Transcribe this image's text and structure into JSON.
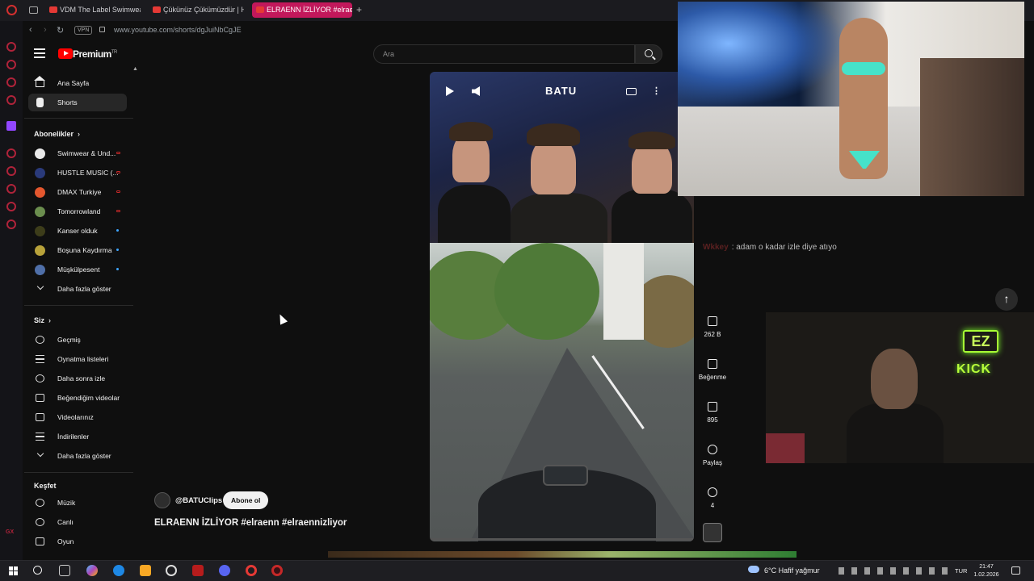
{
  "browser": {
    "tabs": [
      {
        "label": "VDM The Label Swimwear",
        "active": false
      },
      {
        "label": "Çükünüz Çükümüzdür | H",
        "active": false
      },
      {
        "label": "ELRAENN İZLİYOR #elraenn",
        "active": true
      }
    ],
    "vpn_label": "VPN",
    "url": "www.youtube.com/shorts/dgJuiNbCgJE",
    "accent_color": "#c2185b"
  },
  "header": {
    "logo_text": "Premium",
    "logo_sup": "TR",
    "search_placeholder": "Ara"
  },
  "sidebar": {
    "main": [
      {
        "label": "Ana Sayfa",
        "icon": "home-icon"
      },
      {
        "label": "Shorts",
        "icon": "shorts-icon",
        "active": true
      }
    ],
    "subscriptions_title": "Abonelikler",
    "subscriptions": [
      {
        "label": "Swimwear & Und...",
        "avatar_color": "#e9e9e9",
        "status": "live"
      },
      {
        "label": "HUSTLE MUSIC (...",
        "avatar_color": "#2a3a7a",
        "status": "live"
      },
      {
        "label": "DMAX Turkiye",
        "avatar_color": "#e4572e",
        "status": "live"
      },
      {
        "label": "Tomorrowland",
        "avatar_color": "#6b8e4e",
        "status": "live"
      },
      {
        "label": "Kanser olduk",
        "avatar_color": "#3d3d1a",
        "status": "new"
      },
      {
        "label": "Boşuna Kaydırma",
        "avatar_color": "#b8a23a",
        "status": "new"
      },
      {
        "label": "Müşkülpesent",
        "avatar_color": "#4f6fa8",
        "status": "new"
      }
    ],
    "subscriptions_more": "Daha fazla göster",
    "you_title": "Siz",
    "you_items": [
      {
        "label": "Geçmiş",
        "icon": "history-icon"
      },
      {
        "label": "Oynatma listeleri",
        "icon": "playlist-icon"
      },
      {
        "label": "Daha sonra izle",
        "icon": "clock-icon"
      },
      {
        "label": "Beğendiğim videolar",
        "icon": "thumbs-up-icon"
      },
      {
        "label": "Videolarınız",
        "icon": "video-icon"
      },
      {
        "label": "İndirilenler",
        "icon": "download-icon"
      }
    ],
    "you_more": "Daha fazla göster",
    "explore_title": "Keşfet",
    "explore_items": [
      {
        "label": "Müzik",
        "icon": "music-icon"
      },
      {
        "label": "Canlı",
        "icon": "live-icon"
      },
      {
        "label": "Oyun",
        "icon": "gaming-icon"
      }
    ]
  },
  "short": {
    "watermark": "BATU",
    "channel": "@BATUClips",
    "subscribe_label": "Abone ol",
    "title": "ELRAENN İZLİYOR #elraenn #elraennizliyor",
    "actions": {
      "likes": "262 B",
      "dislike_label": "Beğenme",
      "comments": "895",
      "share_label": "Paylaş",
      "remix_count": "4"
    }
  },
  "overlays": {
    "chat_user": "Wkkey",
    "chat_message": ": adam o kadar izle diye atıyo",
    "ez_logo": "EZ",
    "kick_text": "KICK",
    "kick_color": "#b8ff3a"
  },
  "taskbar": {
    "weather": "6°C  Hafif yağmur",
    "language": "TUR",
    "time": "21:47",
    "date": "1.02.2026"
  }
}
